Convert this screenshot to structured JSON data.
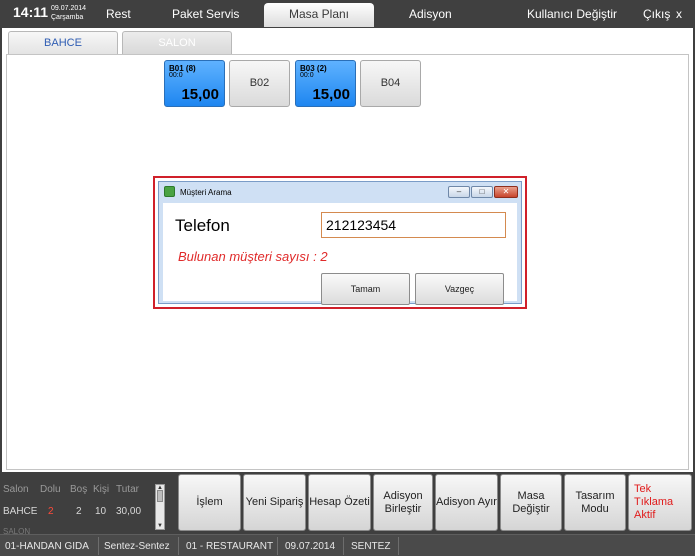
{
  "topbar": {
    "time": "14:11",
    "date": "09.07.2014",
    "weekday": "Çarşamba",
    "menu": {
      "rest": "Rest",
      "paket_servis": "Paket Servis",
      "masa_plani": "Masa Planı",
      "adisyon": "Adisyon",
      "kullanici_degistir": "Kullanıcı Değiştir",
      "cikis": "Çıkış",
      "close": "x"
    }
  },
  "tabs": {
    "bahce": "BAHCE",
    "salon": "SALON"
  },
  "tables": [
    {
      "name": "B01 (8)",
      "time": "00:0",
      "amount": "15,00"
    },
    {
      "name": "B02"
    },
    {
      "name": "B03 (2)",
      "time": "00:0",
      "amount": "15,00"
    },
    {
      "name": "B04"
    }
  ],
  "dialog": {
    "title": "Müşteri Arama",
    "phone_label": "Telefon",
    "phone_value": "212123454",
    "found_text": "Bulunan müşteri sayısı : 2",
    "ok_label": "Tamam",
    "cancel_label": "Vazgeç",
    "controls": {
      "minimize": "–",
      "maximize": "□",
      "close": "✕"
    }
  },
  "stats": {
    "headers": [
      "Salon",
      "Dolu",
      "Boş",
      "Kişi",
      "Tutar"
    ],
    "row": [
      "BAHCE",
      "2",
      "2",
      "10",
      "30,00"
    ],
    "next_row_partial": "SALON"
  },
  "actions": {
    "islem": "İşlem",
    "yeni_siparis": "Yeni Sipariş",
    "hesap_ozeti": "Hesap Özeti",
    "adisyon_birlestir_1": "Adisyon",
    "adisyon_birlestir_2": "Birleştir",
    "adisyon_ayir": "Adisyon Ayır",
    "masa_degistir_1": "Masa",
    "masa_degistir_2": "Değiştir",
    "tasarim_modu_1": "Tasarım",
    "tasarim_modu_2": "Modu",
    "tek_tiklama_1": "Tek Tıklama",
    "tek_tiklama_2": "Aktif"
  },
  "statusbar": {
    "company": "01-HANDAN GIDA",
    "user": "Sentez-Sentez",
    "department": "01 - RESTAURANT",
    "date": "09.07.2014",
    "brand": "SENTEZ"
  },
  "colors": {
    "accent_blue": "#1e86f0",
    "dialog_border_red": "#d0202a",
    "warning_red": "#e02a2a",
    "background_dark": "#3f3f3f"
  }
}
